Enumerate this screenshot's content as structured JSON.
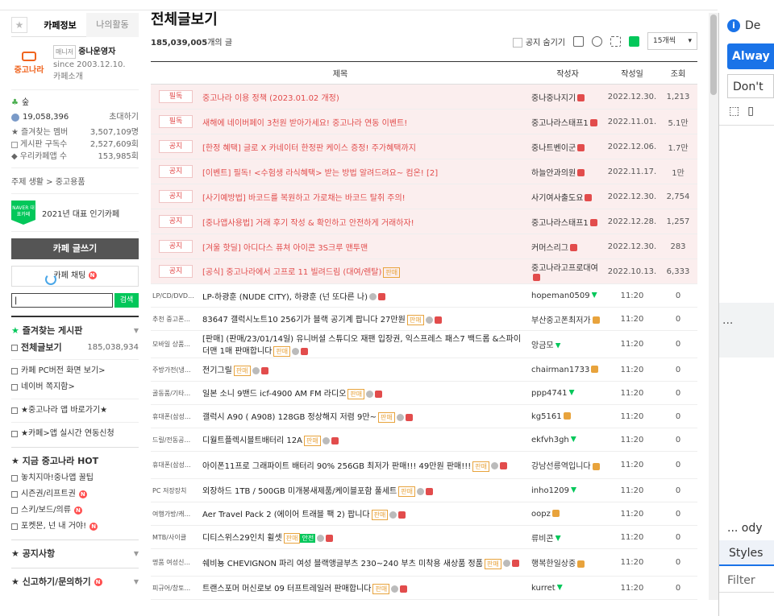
{
  "sidebar": {
    "tab_info": "카페정보",
    "tab_activity": "나의활동",
    "logo_text": "중고나라",
    "manager_badge": "매니저",
    "manager_name": "중나운영자",
    "since": "since 2003.12.10.",
    "cafe_intro": "카페소개",
    "level": "숲",
    "member_count": "19,058,396",
    "invite": "초대하기",
    "stats": [
      {
        "label": "즐겨찾는 멤버",
        "value": "3,507,109명"
      },
      {
        "label": "게시판 구독수",
        "value": "2,527,609회"
      },
      {
        "label": "우리카페앱 수",
        "value": "153,985회"
      }
    ],
    "topic": "주제 생활 > 중고용품",
    "award_badge": "NAVER 대표카페",
    "award_text": "2021년 대표 인기카페",
    "write_button": "카페 글쓰기",
    "chat_button": "카페 채팅",
    "search_value": "|",
    "search_button": "검색",
    "fav_boards": "즐겨찾는 게시판",
    "all_posts": "전체글보기",
    "all_posts_count": "185,038,934",
    "links1": [
      "카페 PC버전 화면 보기>",
      "네이버 쪽지함>"
    ],
    "links2": "★중고나라 앱 바로가기★",
    "links3": "★카페>앱 실시간 연동신청",
    "hot_header": "★ 지금 중고나라 HOT",
    "hot_items": [
      "놓치지마!중나앱 꿀팁",
      "시즌권/리프트권",
      "스키/보드/의류",
      "포켓몬, 넌 내 거야!"
    ],
    "notice_header": "★ 공지사항",
    "report_header": "★ 신고하기/문의하기"
  },
  "main": {
    "title": "전체글보기",
    "count_number": "185,039,005",
    "count_suffix": "개의 글",
    "hide_notice": "공지 숨기기",
    "per_page": "15개씩",
    "columns": {
      "title": "제목",
      "author": "작성자",
      "date": "작성일",
      "views": "조회"
    },
    "notices": [
      {
        "tag": "필독",
        "title": "중고나라 이용 정책 (2023.01.02 개정)",
        "author": "중나중나지기",
        "date": "2022.12.30.",
        "views": "1,213"
      },
      {
        "tag": "필독",
        "title": "새해에 네이버페이 3천원 받아가세요! 중고나라 연동 이벤트!",
        "author": "중고나라스태프1",
        "date": "2022.11.01.",
        "views": "5.1만"
      },
      {
        "tag": "공지",
        "title": "[한정 혜택] 글로 X 카네이터 한정판 케이스 증정! 주가혜택까지",
        "author": "중나트벤이군",
        "date": "2022.12.06.",
        "views": "1.7만"
      },
      {
        "tag": "공지",
        "title": "[이벤트] 필독! <수험생 라식혜택> 받는 방법 알려드려요~ 컴온! [2]",
        "author": "하늘안과의원",
        "date": "2022.11.17.",
        "views": "1만"
      },
      {
        "tag": "공지",
        "title": "[사기예방법] 바코드를 복원하고 가로채는 바코드 탈취 주의!",
        "author": "사기여사출도요",
        "date": "2022.12.30.",
        "views": "2,754"
      },
      {
        "tag": "공지",
        "title": "[중나앱사용법] 거래 후기 작성 & 확인하고 안전하게 거래하자!",
        "author": "중고나라스태프1",
        "date": "2022.12.28.",
        "views": "1,257"
      },
      {
        "tag": "공지",
        "title": "[겨울 핫딜] 아디다스 퓨쳐 아이콘 3S크루 맨투맨",
        "author": "커머스리그",
        "date": "2022.12.30.",
        "views": "283"
      },
      {
        "tag": "공지",
        "title": "[공식] 중고나라에서 고프로 11 빌려드림 (대여/렌탈)",
        "sale": "판매",
        "author": "중고나라고프로대여",
        "date": "2022.10.13.",
        "views": "6,333"
      }
    ],
    "posts": [
      {
        "cat": "LP/CD/DVD...",
        "title": "LP-하광훈 (NUDE CITY), 하광훈 (넌 또다른 나)",
        "author": "hopeman0509",
        "date": "11:20",
        "views": "0"
      },
      {
        "cat": "추천 중고폰...",
        "title": "83647 갤럭시노트10 256기가 블랙 공기계 팝니다 27만원",
        "sale": "판매",
        "author": "부산중고폰최저가",
        "date": "11:20",
        "views": "0"
      },
      {
        "cat": "모바일 상품...",
        "title": "[판매] (판매/23/01/14일) 유니버셜 스튜디오 재팬 입장권, 익스프레스 패스7 백드롭 &스파이더맨 1매 판매합니다",
        "sale": "판매",
        "author": "앙금모",
        "date": "11:20",
        "views": "0"
      },
      {
        "cat": "주방가전(냉...",
        "title": "전기그릴",
        "sale": "판매",
        "author": "chairman1733",
        "date": "11:20",
        "views": "0"
      },
      {
        "cat": "골동품/기타...",
        "title": "일본 소니 9밴드 icf-4900 AM FM 라디오",
        "sale": "판매",
        "author": "ppp4741",
        "date": "11:20",
        "views": "0"
      },
      {
        "cat": "휴대폰(삼성...",
        "title": "갤럭시 A90 ( A908) 128GB 정상해지 저렴 9만~",
        "sale": "판매",
        "author": "kg5161",
        "date": "11:20",
        "views": "0"
      },
      {
        "cat": "드릴/전동공...",
        "title": "디월트플렉시블트배터리 12A",
        "sale": "판매",
        "author": "ekfvh3gh",
        "date": "11:20",
        "views": "0"
      },
      {
        "cat": "휴대폰(삼성...",
        "title": "아이폰11프로 그래파이트 배터리 90% 256GB 최저가 판매!!! 49만원 판매!!!",
        "sale": "판매",
        "author": "강남선릉역입니다",
        "date": "11:20",
        "views": "0"
      },
      {
        "cat": "PC 저장장치",
        "title": "외장하드 1TB / 500GB 미개봉새제품/케이블포함 풀세트",
        "sale": "판매",
        "author": "inho1209",
        "date": "11:20",
        "views": "0"
      },
      {
        "cat": "여행가방/캐...",
        "title": "Aer Travel Pack 2 (에이어 트래블 팩 2) 팝니다",
        "sale": "판매",
        "author": "oopz",
        "date": "11:20",
        "views": "0"
      },
      {
        "cat": "MTB/사이클",
        "title": "디티스위스29인치 휠셋",
        "sale": "판매",
        "safe": "안전",
        "author": "류비콘",
        "date": "11:20",
        "views": "0"
      },
      {
        "cat": "명품 여성신...",
        "title": "쉐비뇽 CHEVIGNON 파리 여성 블랙앵글부츠 230~240 부츠 미착용 새상품 정품",
        "sale": "판매",
        "author": "행복한일상중",
        "date": "11:20",
        "views": "0"
      },
      {
        "cat": "피규어/창토...",
        "title": "트랜스포머 머신로보 09 터프트레일러 판매합니다",
        "sale": "판매",
        "author": "kurret",
        "date": "11:20",
        "views": "0"
      }
    ]
  },
  "devtools": {
    "de": "De",
    "always": "Alway",
    "dont": "Don't",
    "dots": "...",
    "ody": "... ody",
    "styles": "Styles",
    "filter": "Filter"
  },
  "colors": {
    "accent": "#03c75a",
    "notice": "#e24c4c",
    "devtools_blue": "#1a73e8"
  }
}
